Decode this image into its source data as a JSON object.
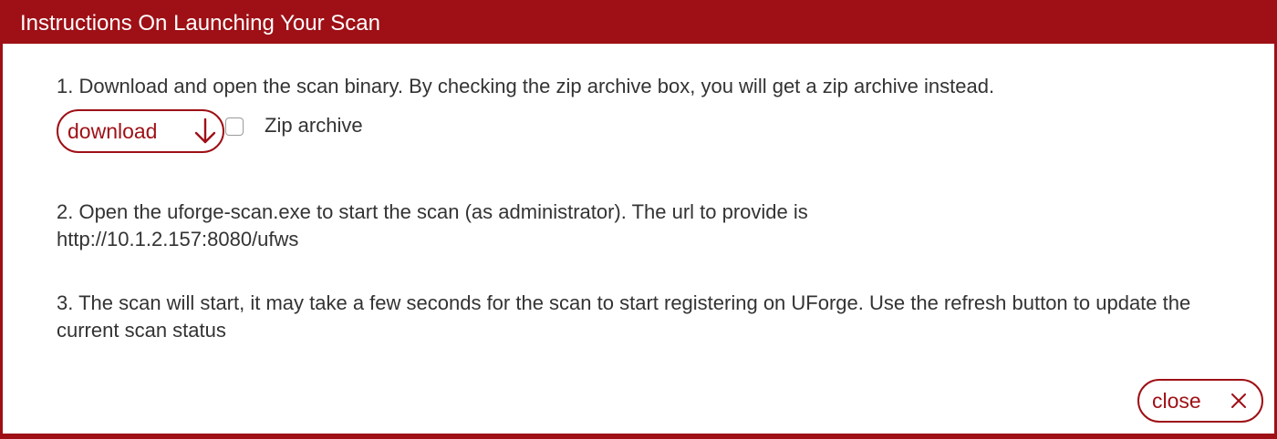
{
  "dialog": {
    "title": "Instructions On Launching Your Scan"
  },
  "steps": {
    "step1": "1. Download and open the scan binary. By checking the zip archive box, you will get a zip archive instead.",
    "step2_line1": "2. Open the uforge-scan.exe to start the scan (as administrator). The url to provide is",
    "step2_line2": "http://10.1.2.157:8080/ufws",
    "step3": "3. The scan will start, it may take a few seconds for the scan to start registering on UForge. Use the refresh button to update the current scan status"
  },
  "download": {
    "label": "download",
    "icon": "arrow-down-icon"
  },
  "zip": {
    "label": "Zip archive",
    "checked": false
  },
  "close": {
    "label": "close",
    "icon": "close-icon"
  },
  "colors": {
    "accent": "#9e1016",
    "text": "#333333"
  }
}
